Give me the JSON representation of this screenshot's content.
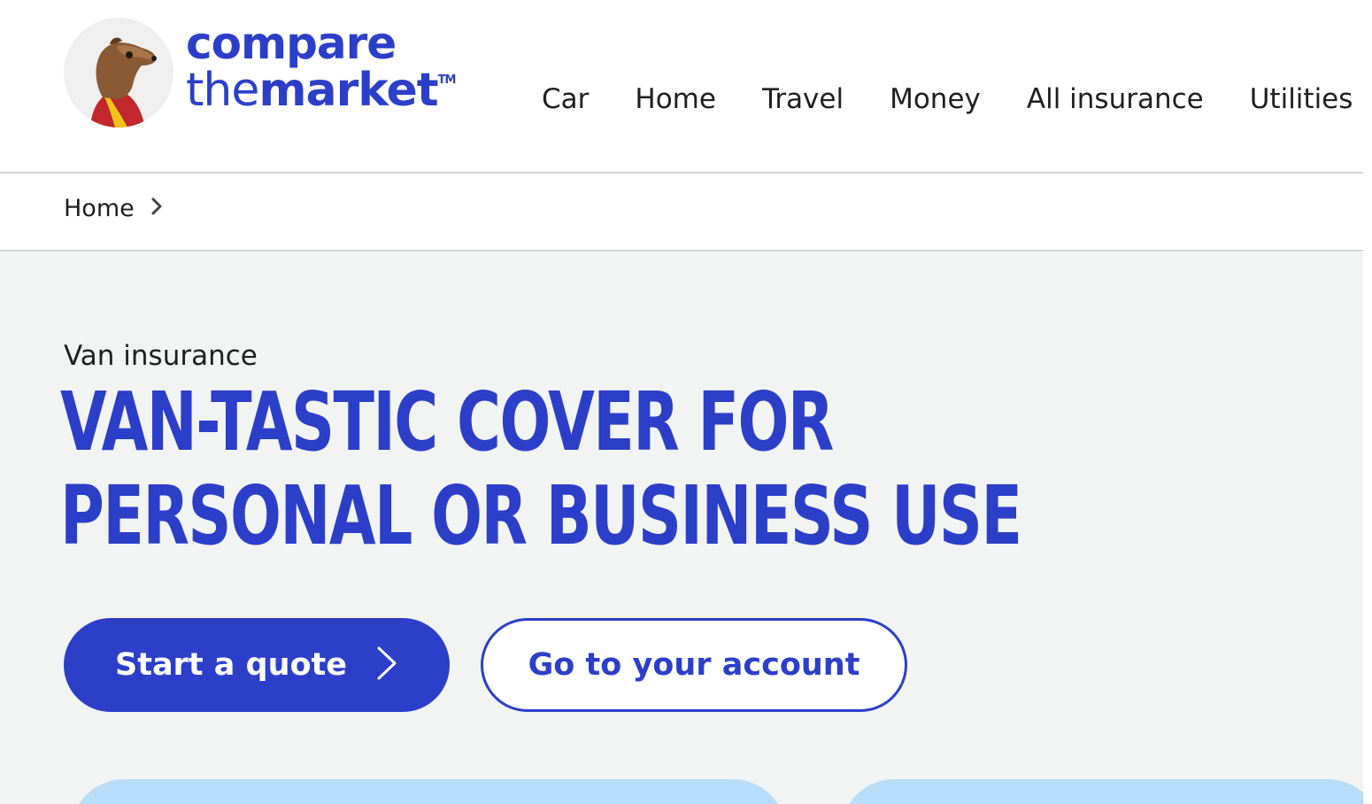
{
  "brand": {
    "line1": "compare",
    "line2_the": "the",
    "line2_market": "market",
    "trademark": "TM",
    "color": "#2b3fc9",
    "mascot_icon": "meerkat-icon"
  },
  "nav": {
    "items": [
      "Car",
      "Home",
      "Travel",
      "Money",
      "All insurance",
      "Utilities"
    ]
  },
  "breadcrumb": {
    "home": "Home",
    "separator_icon": "chevron-right-icon"
  },
  "hero": {
    "eyebrow": "Van insurance",
    "headline_line1": "VAN-TASTIC COVER FOR",
    "headline_line2": "PERSONAL OR BUSINESS USE",
    "primary_button": "Start a quote",
    "primary_button_icon": "chevron-right-icon",
    "secondary_button": "Go to your account",
    "background": "#f2f3f3",
    "card_color": "#b7ddf8"
  }
}
